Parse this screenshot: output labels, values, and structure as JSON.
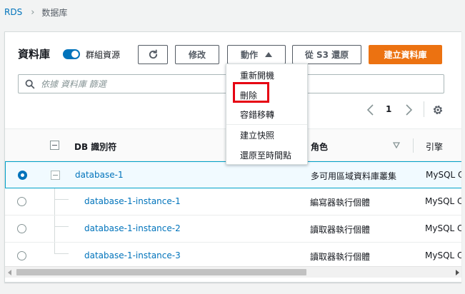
{
  "breadcrumb": {
    "root": "RDS",
    "current": "数据库"
  },
  "panel": {
    "title": "資料庫",
    "group_toggle_label": "群組資源",
    "buttons": {
      "modify": "修改",
      "actions": "動作",
      "restore_s3": "從 S3 還原",
      "create": "建立資料庫"
    },
    "search_placeholder": "依據 資料庫 篩選",
    "page_number": "1"
  },
  "table": {
    "headers": {
      "identifier": "DB 識別符",
      "role": "角色",
      "engine": "引擎"
    },
    "rows": [
      {
        "name": "database-1",
        "role": "多可用區域資料庫叢集",
        "engine": "MySQL C"
      },
      {
        "name": "database-1-instance-1",
        "role": "編寫器執行個體",
        "engine": "MySQL C"
      },
      {
        "name": "database-1-instance-2",
        "role": "讀取器執行個體",
        "engine": "MySQL C"
      },
      {
        "name": "database-1-instance-3",
        "role": "讀取器執行個體",
        "engine": "MySQL C"
      }
    ]
  },
  "actions_menu": {
    "items": [
      "重新開機",
      "刪除",
      "容錯移轉",
      "建立快照",
      "還原至時間點"
    ]
  },
  "colors": {
    "accent": "#0073bb",
    "primary_button": "#ec7211",
    "highlight": "#e60012"
  },
  "icons": {
    "refresh": "refresh-icon",
    "search": "search-icon",
    "settings": "gear-icon",
    "pager_prev": "chevron-left-icon",
    "pager_next": "chevron-right-icon",
    "sort": "sort-descending-icon"
  }
}
